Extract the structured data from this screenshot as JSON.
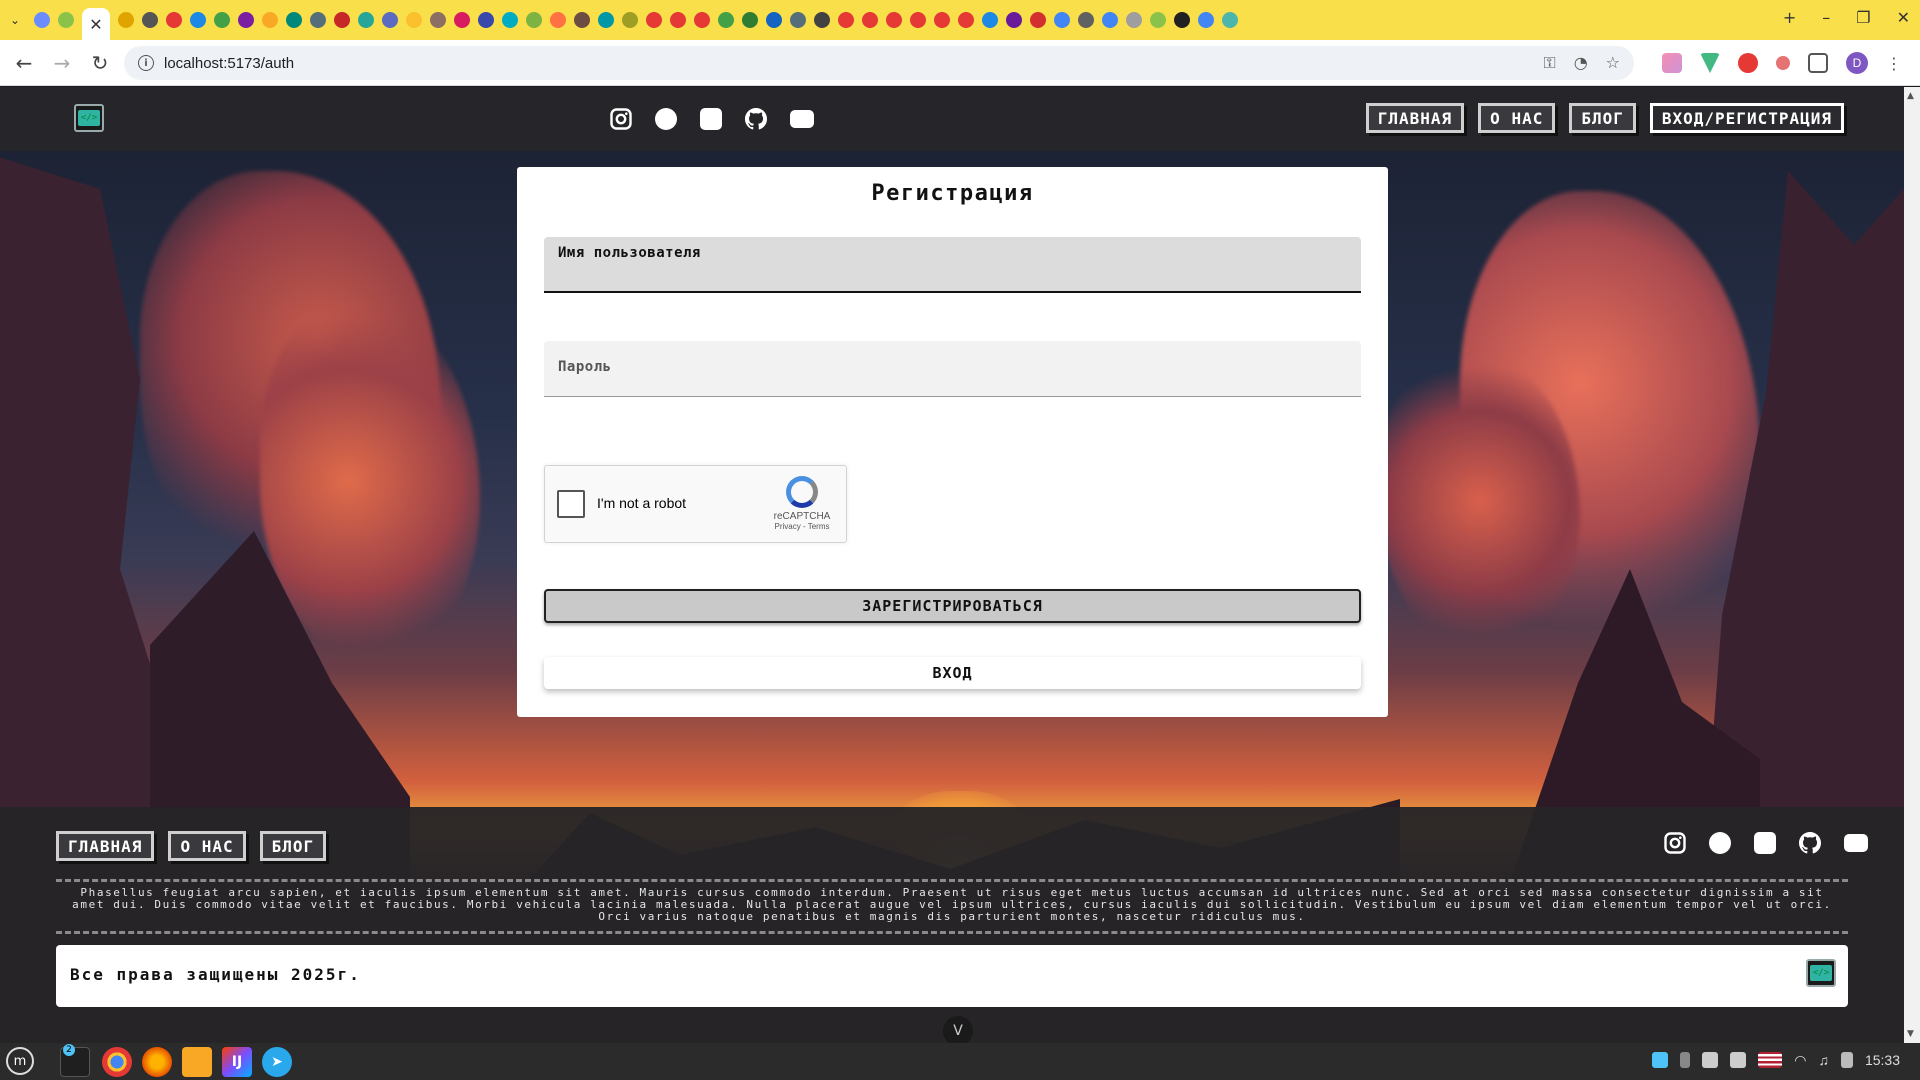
{
  "browser": {
    "url": "localhost:5173/auth",
    "tab_close": "✕",
    "new_tab": "+",
    "profile_initial": "D",
    "tab_favicon_colors": [
      "#6a8cff",
      "#8bc34a",
      "#e0a400",
      "#555",
      "#e53935",
      "#1e88e5",
      "#43a047",
      "#7b1fa2",
      "#f9a825",
      "#00897b",
      "#546e7a",
      "#c62828",
      "#26a69a",
      "#5c6bc0",
      "#fbc02d",
      "#8d6e63",
      "#d81b60",
      "#3949ab",
      "#00acc1",
      "#7cb342",
      "#ff7043",
      "#6d4c41",
      "#0097a7",
      "#9e9d24",
      "#e53935",
      "#e53935",
      "#e53935",
      "#43a047",
      "#2e7d32",
      "#1565c0",
      "#546e7a",
      "#424242",
      "#e53935",
      "#e53935",
      "#e53935",
      "#e53935",
      "#e53935",
      "#e53935",
      "#1e88e5",
      "#6a1b9a",
      "#d32f2f",
      "#4285f4",
      "#616161",
      "#4285f4",
      "#9e9e9e",
      "#8bc34a",
      "#212121",
      "#4285f4",
      "#4db6ac"
    ]
  },
  "header": {
    "nav": [
      "ГЛАВНАЯ",
      "О НАС",
      "БЛОГ",
      "ВХОД/РЕГИСТРАЦИЯ"
    ],
    "social_icons": [
      "instagram-icon",
      "circle-icon",
      "square-icon",
      "github-icon",
      "youtube-icon"
    ]
  },
  "auth": {
    "title": "Регистрация",
    "username_label": "Имя пользователя",
    "password_label": "Пароль",
    "captcha_text": "I'm not a robot",
    "captcha_brand": "reCAPTCHA",
    "captcha_links": "Privacy - Terms",
    "register_button": "ЗАРЕГИСТРИРОВАТЬСЯ",
    "login_button": "ВХОД"
  },
  "footer": {
    "nav": [
      "ГЛАВНАЯ",
      "О НАС",
      "БЛОГ"
    ],
    "lorem": "Phasellus feugiat arcu sapien, et iaculis ipsum elementum sit amet. Mauris cursus commodo interdum. Praesent ut risus eget metus luctus accumsan id ultrices nunc. Sed at orci sed massa consectetur dignissim a sit amet dui. Duis commodo vitae velit et faucibus. Morbi vehicula lacinia malesuada. Nulla placerat augue vel ipsum ultrices, cursus iaculis dui sollicitudin. Vestibulum eu ipsum vel diam elementum tempor vel ut orci. Orci varius natoque penatibus et magnis dis parturient montes, nascetur ridiculus mus.",
    "copyright": "Все права защищены 2025г.",
    "scroll_down": "V"
  },
  "taskbar": {
    "badge": "2",
    "clock": "15:33"
  }
}
